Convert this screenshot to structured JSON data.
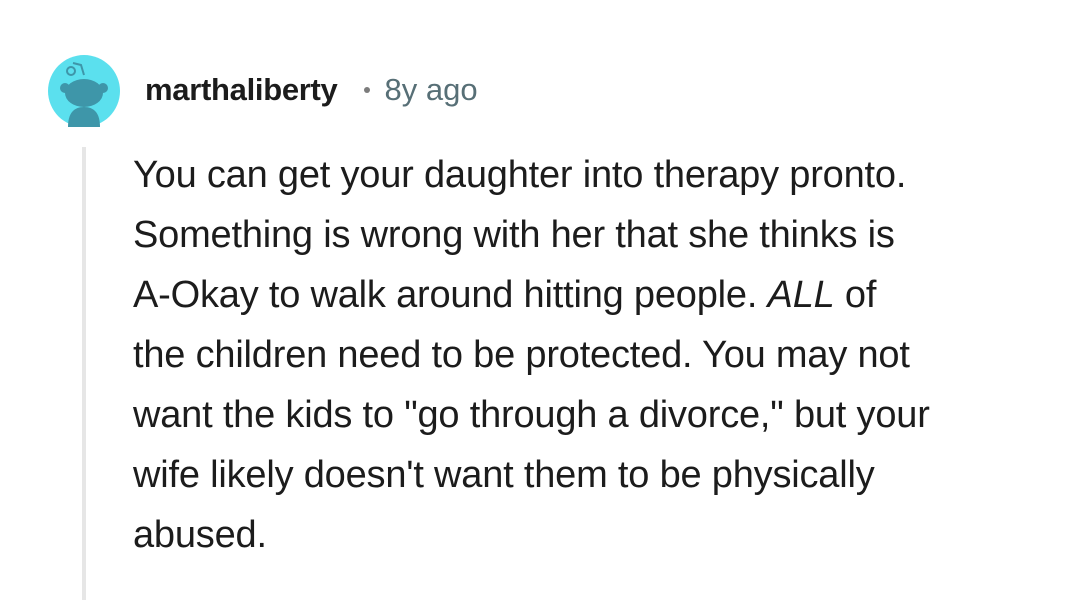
{
  "comment": {
    "author": "marthaliberty",
    "age": "8y ago",
    "avatar_icon": "reddit-snoo-avatar-icon",
    "avatar_bg": "#5be0ee",
    "avatar_fg": "#3e96a9",
    "body": {
      "l1": "You can get your daughter into therapy pronto.",
      "l2": "Something is wrong with her that she thinks is",
      "l3a": "A-Okay to walk around hitting people. ",
      "l3em": "ALL",
      "l3b": " of",
      "l4": "the children need to be protected. You may not",
      "l5": "want the kids to \"go through a divorce,\" but your",
      "l6": "wife likely doesn't want them to be physically",
      "l7": "abused."
    }
  }
}
